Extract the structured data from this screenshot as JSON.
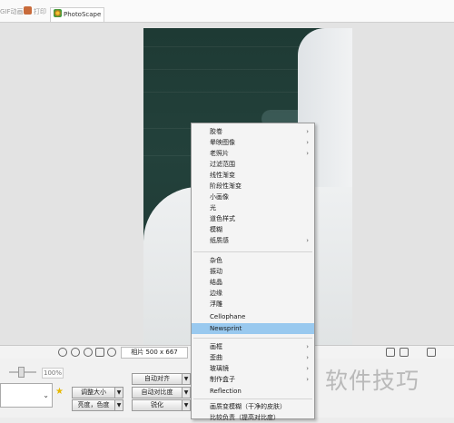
{
  "tabs": [
    {
      "label": "GIF动画",
      "icon": "gif-icon"
    },
    {
      "label": "打印",
      "icon": "print-icon"
    },
    {
      "label": "PhotoScape",
      "icon": "photoscape-icon"
    }
  ],
  "status": {
    "photo_size": "相片 500 x 667"
  },
  "bottom": {
    "zoom_pct": "100%",
    "buttons": {
      "resize": "调整大小",
      "brightness_color": "亮度，色度",
      "auto_level": "自动对齐",
      "auto_contrast": "自动对比度",
      "sharpen": "锐化"
    }
  },
  "menu": {
    "group1": [
      {
        "label": "胶卷",
        "sub": true
      },
      {
        "label": "晕映图像",
        "sub": true
      },
      {
        "label": "老照片",
        "sub": true
      },
      {
        "label": "过滤范围",
        "sub": false
      },
      {
        "label": "线性渐变",
        "sub": false
      },
      {
        "label": "阶段性渐变",
        "sub": false
      },
      {
        "label": "小画像",
        "sub": false
      },
      {
        "label": "光",
        "sub": false
      },
      {
        "label": "道色样式",
        "sub": false
      },
      {
        "label": "模糊",
        "sub": false
      },
      {
        "label": "纸质感",
        "sub": true
      }
    ],
    "group2": [
      {
        "label": "杂色",
        "sub": false
      },
      {
        "label": "振动",
        "sub": false
      },
      {
        "label": "结晶",
        "sub": false
      },
      {
        "label": "边缘",
        "sub": false
      },
      {
        "label": "浮雕",
        "sub": false
      },
      {
        "label": "Cellophane",
        "sub": false
      },
      {
        "label": "Newsprint",
        "sub": false,
        "highlight": true
      }
    ],
    "group3": [
      {
        "label": "画框",
        "sub": true
      },
      {
        "label": "歪曲",
        "sub": true
      },
      {
        "label": "玻璃镜",
        "sub": true
      },
      {
        "label": "制作盒子",
        "sub": true
      },
      {
        "label": "Reflection",
        "sub": false
      }
    ],
    "group4": [
      {
        "label": "画质变模糊（干净的皮肤）",
        "sub": false
      },
      {
        "label": "比较负责（提高对比度）",
        "sub": false
      }
    ]
  },
  "watermark": "软件技巧"
}
